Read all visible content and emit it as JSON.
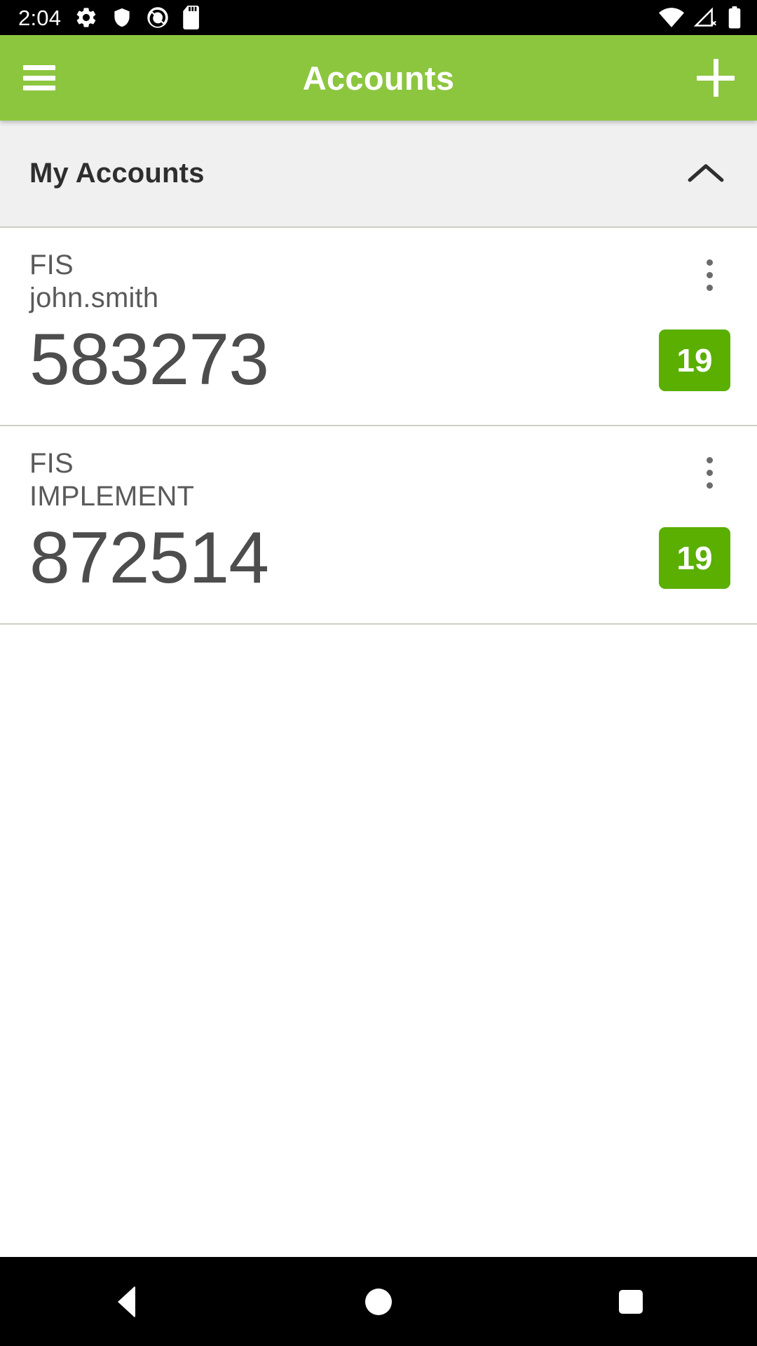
{
  "status_bar": {
    "time": "2:04",
    "left_icons": [
      "gear-icon",
      "shield-icon",
      "circle-q-icon",
      "sd-card-icon"
    ],
    "right_icons": [
      "wifi-icon",
      "cellular-no-signal-icon",
      "battery-icon"
    ]
  },
  "app_bar": {
    "menu_icon": "hamburger-menu-icon",
    "title": "Accounts",
    "add_icon": "plus-icon",
    "background_color": "#8cc63f",
    "title_color": "#ffffff"
  },
  "section": {
    "title": "My Accounts",
    "collapse_icon": "chevron-up-icon",
    "background_color": "#f0f0f0"
  },
  "accounts": [
    {
      "issuer": "FIS",
      "username": "john.smith",
      "code": "583273",
      "countdown": "19",
      "overflow_icon": "more-vertical-icon",
      "badge_color": "#5aaf00"
    },
    {
      "issuer": "FIS",
      "username": "IMPLEMENT",
      "code": "872514",
      "countdown": "19",
      "overflow_icon": "more-vertical-icon",
      "badge_color": "#5aaf00"
    }
  ],
  "nav_bar": {
    "back_icon": "back-triangle-icon",
    "home_icon": "home-circle-icon",
    "recents_icon": "recents-square-icon"
  }
}
